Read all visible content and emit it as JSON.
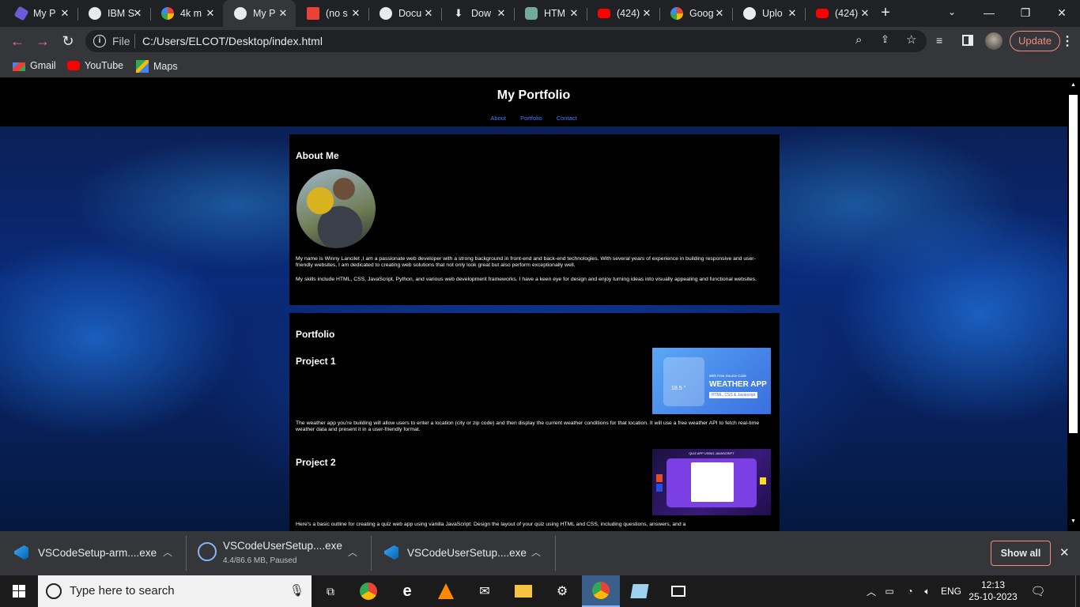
{
  "tabs": [
    {
      "title": "My P",
      "icon": "hexagon-icon",
      "color": "#8b7bf0"
    },
    {
      "title": "IBM S",
      "icon": "globe-icon",
      "color": "#ffffff"
    },
    {
      "title": "4k m",
      "icon": "google-icon",
      "color": "#ffffff"
    },
    {
      "title": "My P",
      "icon": "globe-icon",
      "color": "#ffffff",
      "active": true
    },
    {
      "title": "(no s",
      "icon": "gmail-icon",
      "color": "#ea4335"
    },
    {
      "title": "Docu",
      "icon": "globe-icon",
      "color": "#ffffff"
    },
    {
      "title": "Dow",
      "icon": "download-icon",
      "color": "#ffffff"
    },
    {
      "title": "HTM",
      "icon": "chatgpt-icon",
      "color": "#74aa9c"
    },
    {
      "title": "(424)",
      "icon": "youtube-icon",
      "color": "#ff0000"
    },
    {
      "title": "Goog",
      "icon": "google-icon",
      "color": "#ffffff"
    },
    {
      "title": "Uplo",
      "icon": "github-icon",
      "color": "#ffffff"
    },
    {
      "title": "(424)",
      "icon": "youtube-icon",
      "color": "#ff0000"
    }
  ],
  "address": {
    "scheme_label": "File",
    "url": "C:/Users/ELCOT/Desktop/index.html",
    "update_label": "Update"
  },
  "bookmarks": [
    {
      "label": "Gmail",
      "icon": "gmail-icon"
    },
    {
      "label": "YouTube",
      "icon": "youtube-icon"
    },
    {
      "label": "Maps",
      "icon": "maps-icon"
    }
  ],
  "site": {
    "title": "My Portfolio",
    "nav": [
      "About",
      "Portfolio",
      "Contact"
    ],
    "about": {
      "heading": "About Me",
      "p1": "My name is Winny Lancilet ,I am a passionate web developer with a strong background in front-end and back-end technologies. With several years of experience in building responsive and user-friendly websites, I am dedicated to creating web solutions that not only look great but also perform exceptionally well.",
      "p2": "My skills include HTML, CSS, JavaScript, Python, and various web development frameworks. I have a keen eye for design and enjoy turning ideas into visually appealing and functional websites."
    },
    "portfolio": {
      "heading": "Portfolio",
      "projects": [
        {
          "title": "Project 1",
          "desc": "The weather app you're building will allow users to enter a location (city or zip code) and then display the current weather conditions for that location. It will use a free weather API to fetch real-time weather data and present it in a user-friendly format.",
          "img_caption1": "With Free Source Code",
          "img_caption2": "WEATHER APP",
          "img_caption3": "HTML, CSS & Javascript",
          "img_temp": "18.5 °"
        },
        {
          "title": "Project 2",
          "desc": "Here's a basic outline for creating a quiz web app using vanilla JavaScript: Design the layout of your quiz using HTML and CSS, including questions, answers, and a",
          "img_caption1": "QUIZ APP USING JAVASCRIPT"
        }
      ]
    }
  },
  "downloads": [
    {
      "name": "VSCodeSetup-arm....exe",
      "status": ""
    },
    {
      "name": "VSCodeUserSetup....exe",
      "status": "4.4/86.6 MB, Paused"
    },
    {
      "name": "VSCodeUserSetup....exe",
      "status": ""
    }
  ],
  "shelf": {
    "show_all": "Show all"
  },
  "taskbar": {
    "search_placeholder": "Type here to search",
    "lang": "ENG",
    "time": "12:13",
    "date": "25-10-2023"
  }
}
